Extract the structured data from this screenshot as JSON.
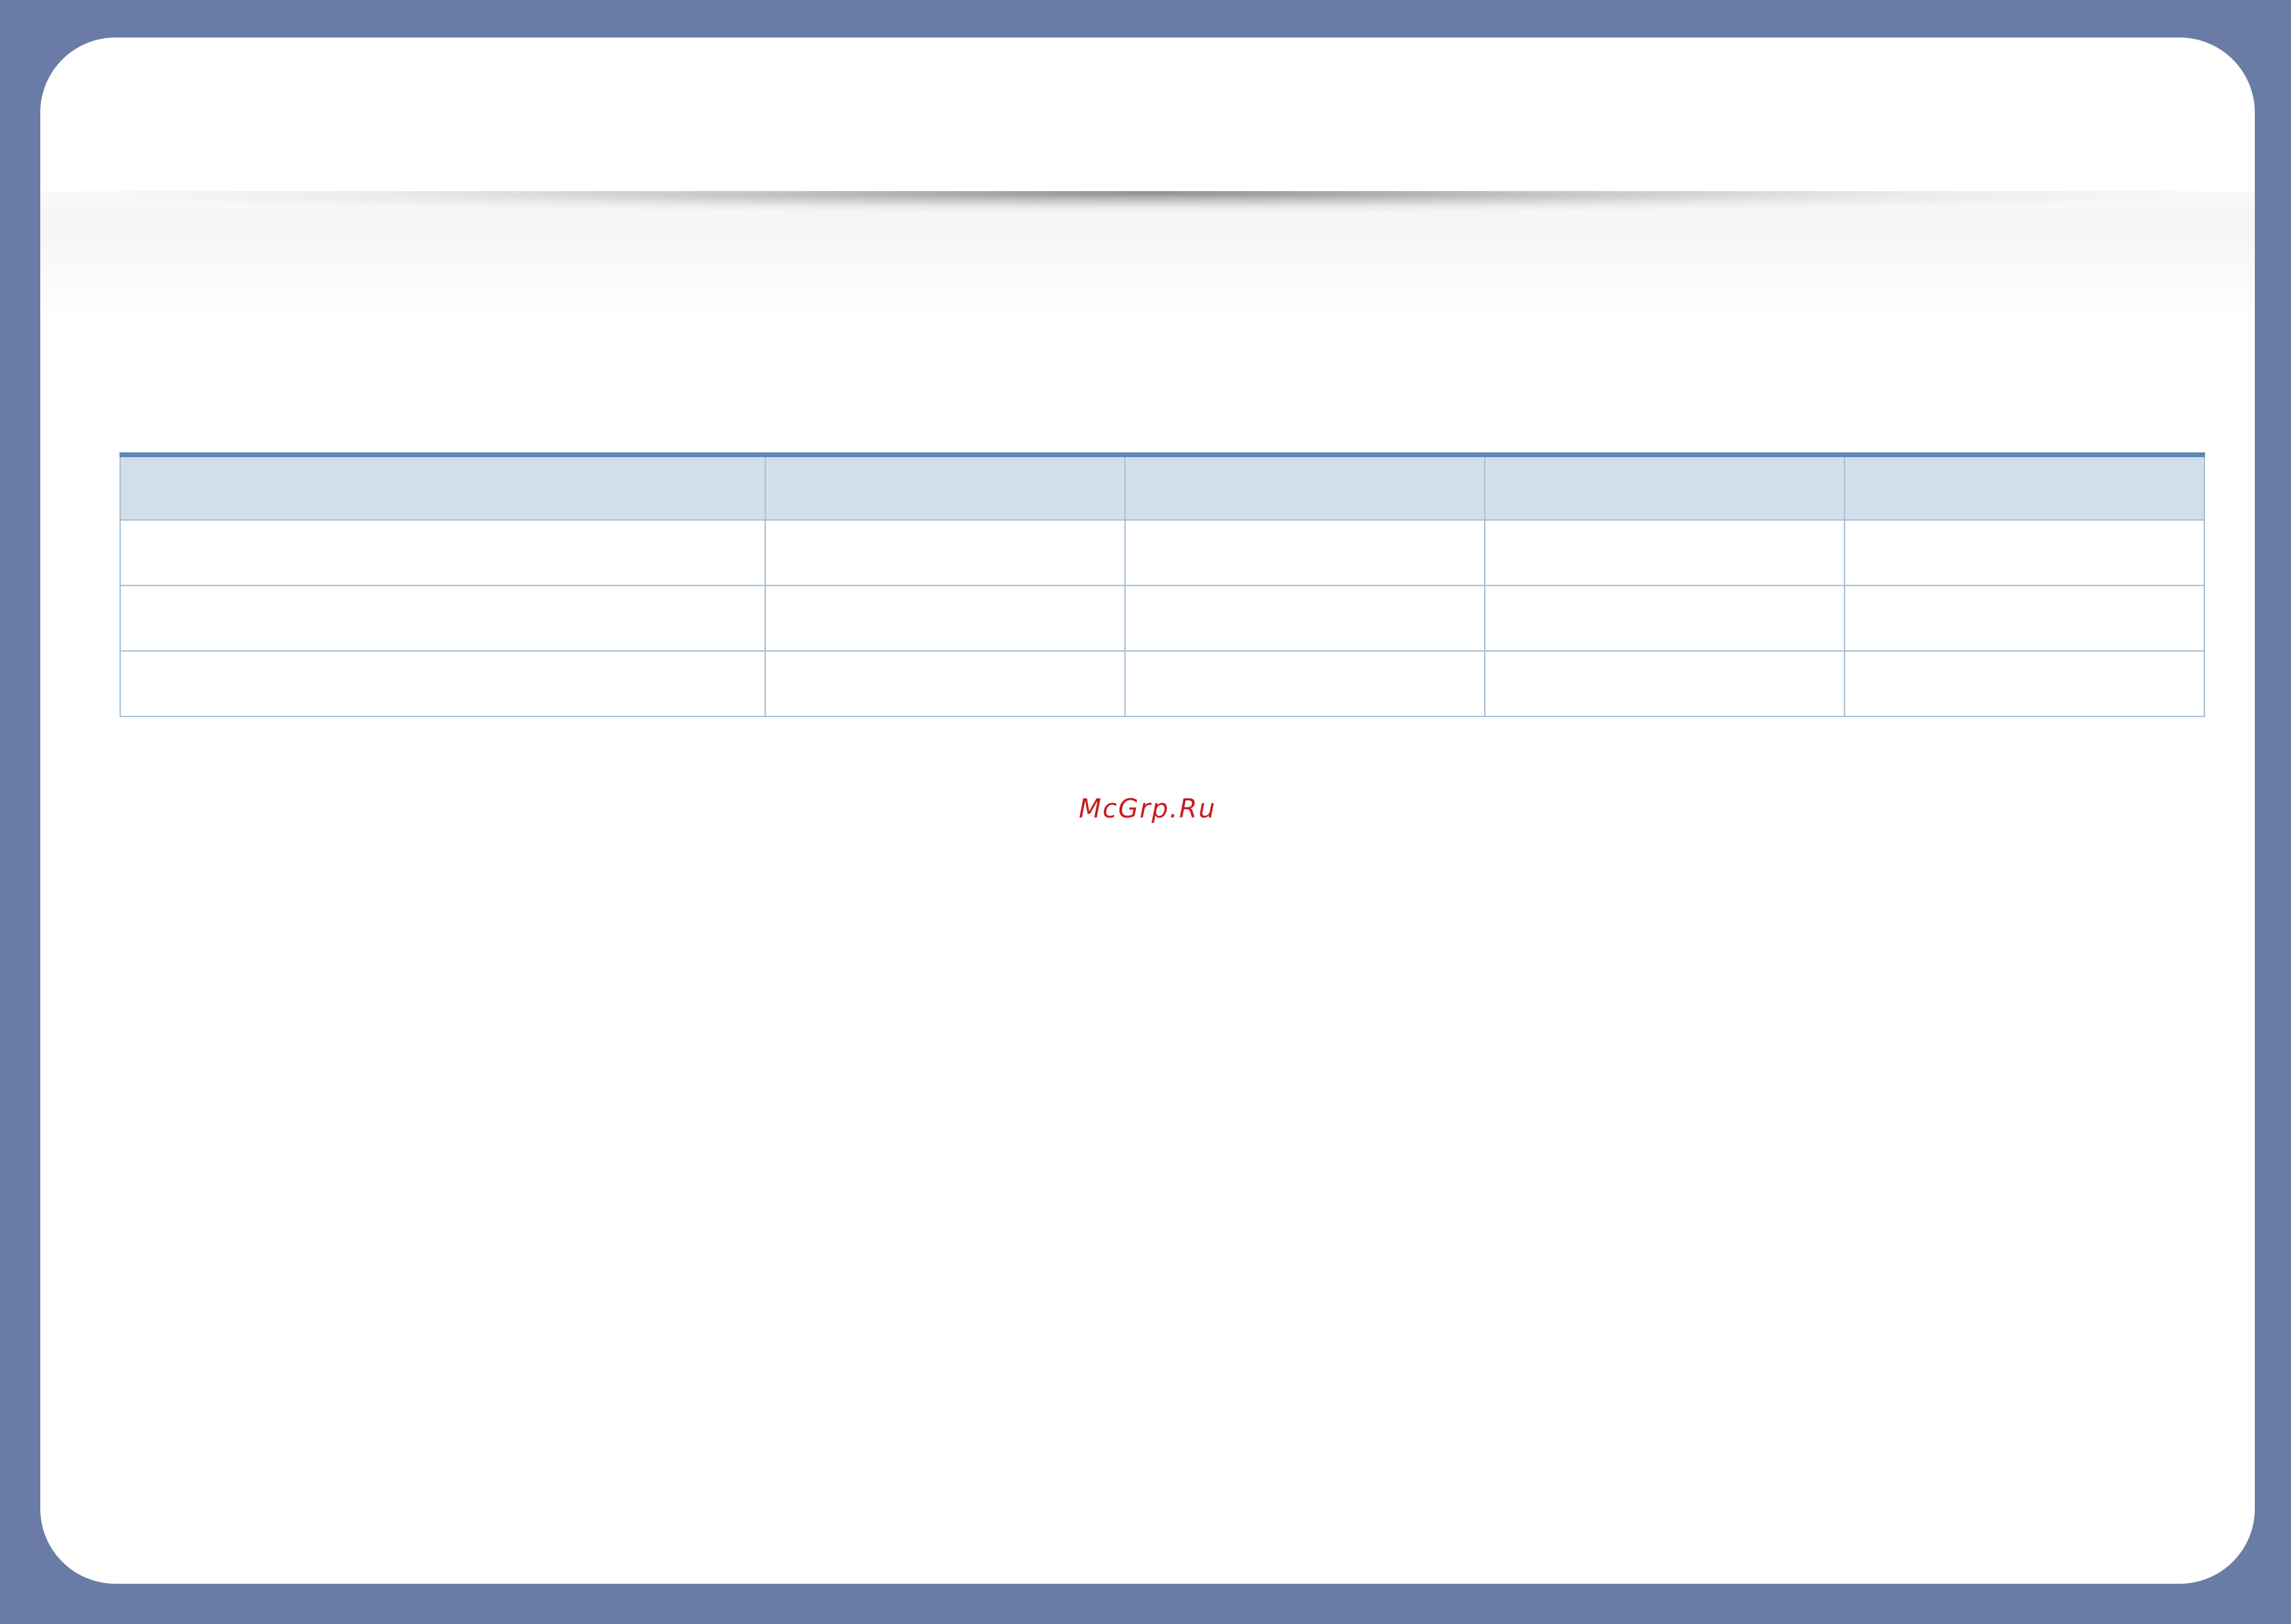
{
  "table": {
    "headers": [
      "",
      "",
      "",
      "",
      ""
    ],
    "rows": [
      [
        "",
        "",
        "",
        "",
        ""
      ],
      [
        "",
        "",
        "",
        "",
        ""
      ],
      [
        "",
        "",
        "",
        "",
        ""
      ]
    ]
  },
  "watermark": {
    "text": "McGrp.Ru",
    "color": "#c61c1c"
  },
  "colors": {
    "frame": "#6a7ca6",
    "table_header_bg": "#d2dee9",
    "table_header_rule": "#5b88b5",
    "table_border": "#a9c1d9"
  }
}
